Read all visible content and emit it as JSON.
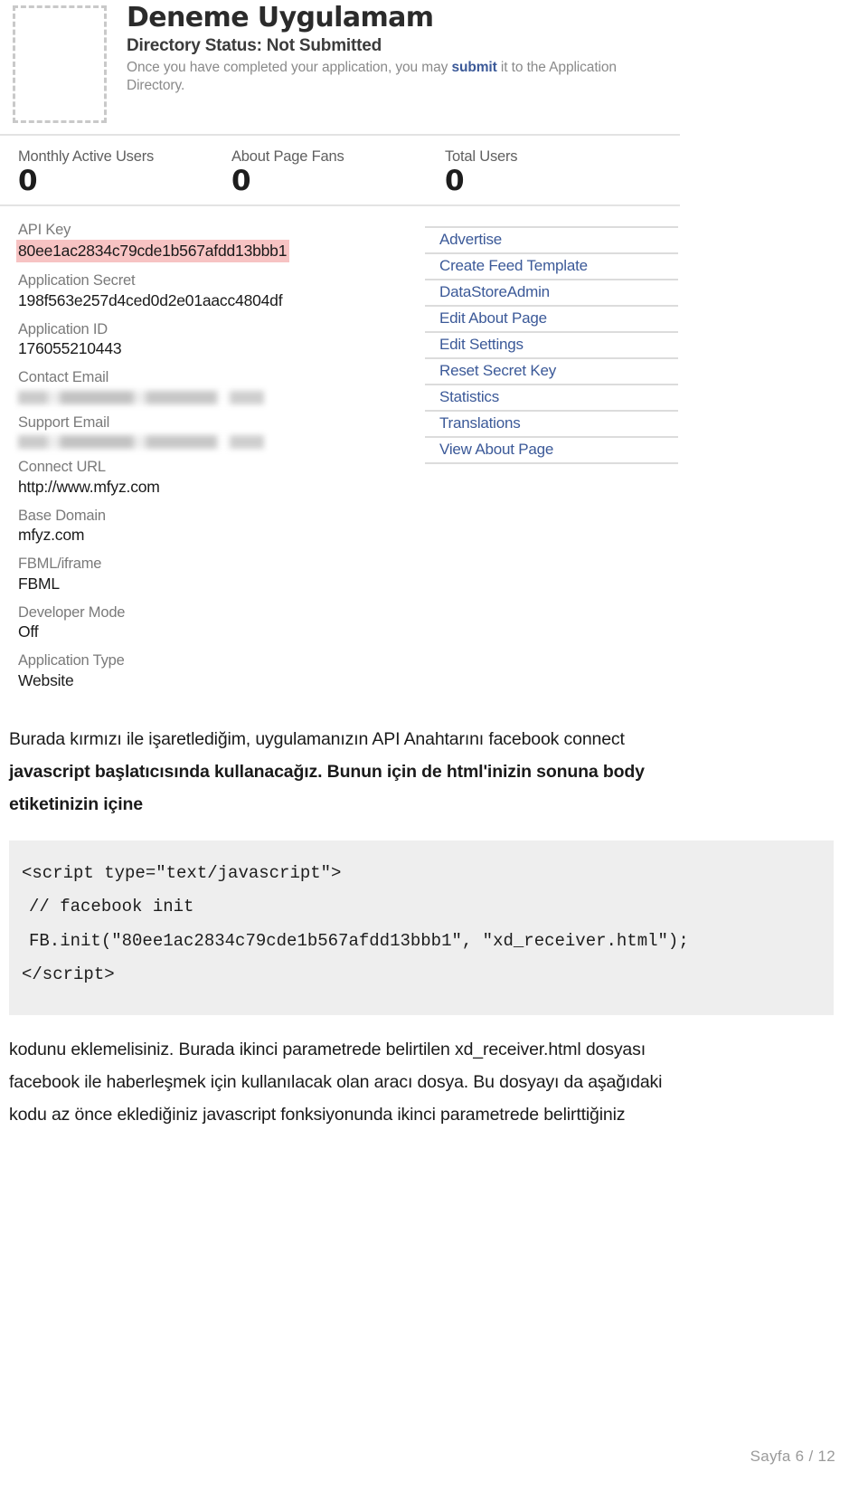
{
  "screenshot": {
    "app": {
      "title": "Deneme Uygulamam",
      "directory_status": "Directory Status: Not Submitted",
      "note_before_link": "Once you have completed your application, you may ",
      "note_link": "submit",
      "note_after_link": " it to the Application Directory.",
      "thumbnail_alt": "application-thumbnail-placeholder"
    },
    "stats": [
      {
        "label": "Monthly Active Users",
        "value": "0"
      },
      {
        "label": "About Page Fans",
        "value": "0"
      },
      {
        "label": "Total Users",
        "value": "0"
      }
    ],
    "fields": [
      {
        "label": "API Key",
        "value": "80ee1ac2834c79cde1b567afdd13bbb1",
        "highlight": true
      },
      {
        "label": "Application Secret",
        "value": "198f563e257d4ced0d2e01aacc4804df",
        "highlight": false
      },
      {
        "label": "Application ID",
        "value": "176055210443",
        "highlight": false
      },
      {
        "label": "Contact Email",
        "value": "",
        "redacted": true
      },
      {
        "label": "Support Email",
        "value": "",
        "redacted": true
      },
      {
        "label": "Connect URL",
        "value": "http://www.mfyz.com",
        "highlight": false
      },
      {
        "label": "Base Domain",
        "value": "mfyz.com",
        "highlight": false
      },
      {
        "label": "FBML/iframe",
        "value": "FBML",
        "highlight": false
      },
      {
        "label": "Developer Mode",
        "value": "Off",
        "highlight": false
      },
      {
        "label": "Application Type",
        "value": "Website",
        "highlight": false
      }
    ],
    "links": [
      {
        "label": "Advertise"
      },
      {
        "label": "Create Feed Template"
      },
      {
        "label": "DataStoreAdmin"
      },
      {
        "label": "Edit About Page"
      },
      {
        "label": "Edit Settings"
      },
      {
        "label": "Reset Secret Key"
      },
      {
        "label": "Statistics"
      },
      {
        "label": "Translations"
      },
      {
        "label": "View About Page"
      }
    ],
    "highlight_color": "#f7c3c3",
    "link_color": "#3b5998"
  },
  "document": {
    "intro_line1": "Burada kırmızı ile işaretlediğim, uygulamanızın API Anahtarını facebook connect",
    "intro_line2": "javascript başlatıcısında kullanacağız. Bunun için de html'inizin sonuna body",
    "intro_line3": "etiketinizin içine",
    "code": [
      "<script type=\"text/javascript\">",
      "// facebook init",
      "FB.init(\"80ee1ac2834c79cde1b567afdd13bbb1\", \"xd_receiver.html\");",
      "</script>"
    ],
    "tail_line1": "kodunu eklemelisiniz. Burada ikinci parametrede belirtilen xd_receiver.html dosyası",
    "tail_line2": "facebook ile haberleşmek için kullanılacak olan aracı dosya. Bu dosyayı da aşağıdaki",
    "tail_line3": "kodu az önce eklediğiniz javascript fonksiyonunda ikinci parametrede belirttiğiniz"
  },
  "footer": {
    "page_indicator": "Sayfa 6 / 12"
  }
}
